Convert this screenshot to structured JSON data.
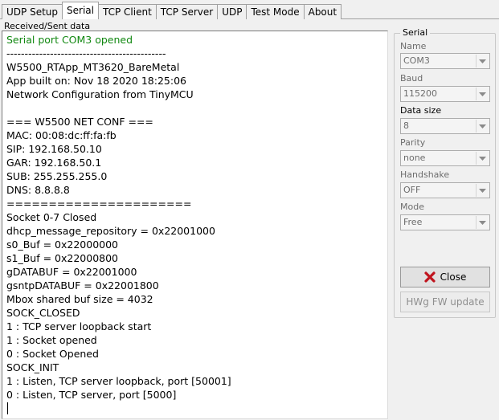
{
  "tabs": [
    {
      "label": "UDP Setup"
    },
    {
      "label": "Serial"
    },
    {
      "label": "TCP Client"
    },
    {
      "label": "TCP Server"
    },
    {
      "label": "UDP"
    },
    {
      "label": "Test Mode"
    },
    {
      "label": "About"
    }
  ],
  "active_tab": "Serial",
  "received_label": "Received/Sent data",
  "console": {
    "lines": [
      "Serial port COM3 opened",
      "--------------------------------------------",
      "W5500_RTApp_MT3620_BareMetal",
      "App built on: Nov 18 2020 18:25:06",
      "Network Configuration from TinyMCU",
      "",
      "=== W5500 NET CONF ===",
      "MAC: 00:08:dc:ff:fa:fb",
      "SIP: 192.168.50.10",
      "GAR: 192.168.50.1",
      "SUB: 255.255.255.0",
      "DNS: 8.8.8.8",
      "======================",
      "Socket 0-7 Closed",
      "dhcp_message_repository = 0x22001000",
      "s0_Buf = 0x22000000",
      "s1_Buf = 0x22000800",
      "gDATABUF = 0x22001000",
      "gsntpDATABUF = 0x22001800",
      "Mbox shared buf size = 4032",
      "SOCK_CLOSED",
      "1 : TCP server loopback start",
      "1 : Socket opened",
      "0 : Socket Opened",
      "SOCK_INIT",
      "1 : Listen, TCP server loopback, port [50001]",
      "0 : Listen, TCP server, port [5000]"
    ],
    "highlight_color": "#118811"
  },
  "serial": {
    "title": "Serial",
    "name_label": "Name",
    "name_value": "COM3",
    "baud_label": "Baud",
    "baud_value": "115200",
    "data_size_label": "Data size",
    "data_size_value": "8",
    "parity_label": "Parity",
    "parity_value": "none",
    "handshake_label": "Handshake",
    "handshake_value": "OFF",
    "mode_label": "Mode",
    "mode_value": "Free",
    "close_label": "Close",
    "close_icon": "red-x-icon",
    "close_icon_color": "#c0141e",
    "hwg_label": "HWg FW update"
  }
}
